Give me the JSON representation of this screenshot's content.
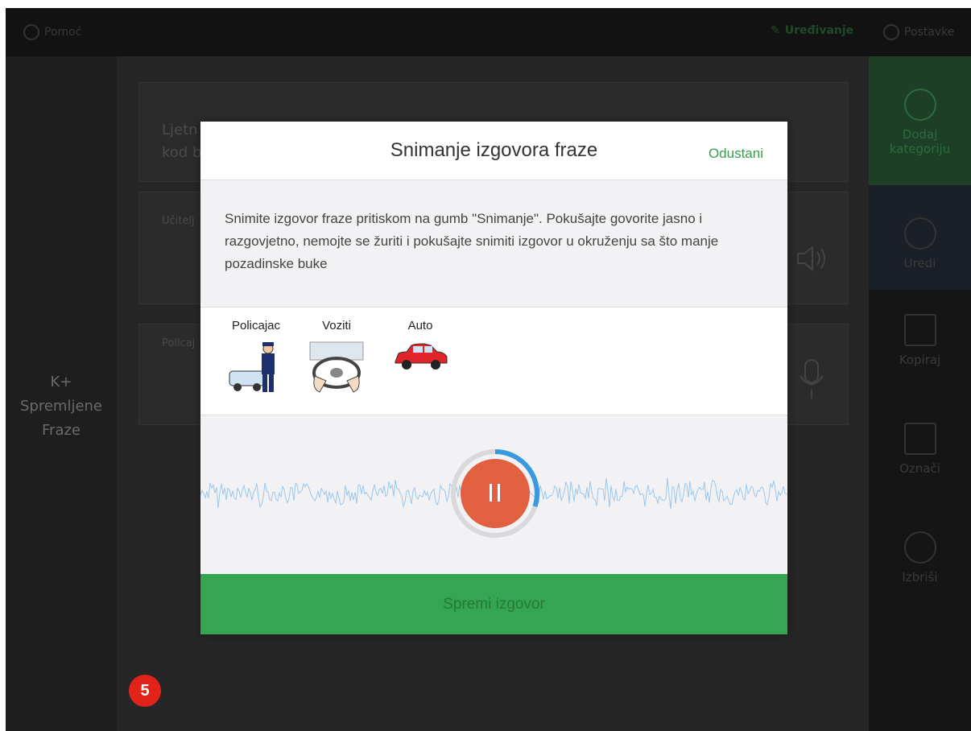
{
  "topbar": {
    "help_label": "Pomoć",
    "edit_label": "Uređivanje",
    "settings_label": "Postavke"
  },
  "left": {
    "category_line1": "K+",
    "category_line2": "Spremljene",
    "category_line3": "Fraze"
  },
  "background_cards": [
    {
      "text_line1": "Ljetn",
      "text_line2": "kod b"
    },
    {
      "text_line1": "Učitelj"
    },
    {
      "text_line1": "Policaj"
    }
  ],
  "sidebar": {
    "items": [
      {
        "label_line1": "Dodaj",
        "label_line2": "kategoriju",
        "icon": "plus-circle-icon"
      },
      {
        "label_line1": "Uredi",
        "icon": "pencil-icon"
      },
      {
        "label_line1": "Kopiraj",
        "icon": "copy-icon"
      },
      {
        "label_line1": "Označi",
        "icon": "checkbox-icon"
      },
      {
        "label_line1": "Izbriši",
        "icon": "close-circle-icon"
      }
    ]
  },
  "badge": {
    "number": "5",
    "color": "#e2231a"
  },
  "modal": {
    "title": "Snimanje izgovora fraze",
    "cancel_label": "Odustani",
    "description": "Snimite izgovor fraze pritiskom na gumb \"Snimanje\". Pokušajte govorite jasno i razgovjetno, nemojte se žuriti i pokušajte snimiti izgovor u okruženju sa što manje pozadinske buke",
    "symbols": [
      {
        "label": "Policajac",
        "icon": "policeman-icon"
      },
      {
        "label": "Voziti",
        "icon": "steering-wheel-icon"
      },
      {
        "label": "Auto",
        "icon": "car-icon"
      }
    ],
    "record": {
      "state": "recording",
      "progress": 0.3,
      "accent": "#e0603f",
      "ring_color": "#3a9ae0"
    },
    "save_label": "Spremi izgovor",
    "save_color": "#35a551"
  }
}
